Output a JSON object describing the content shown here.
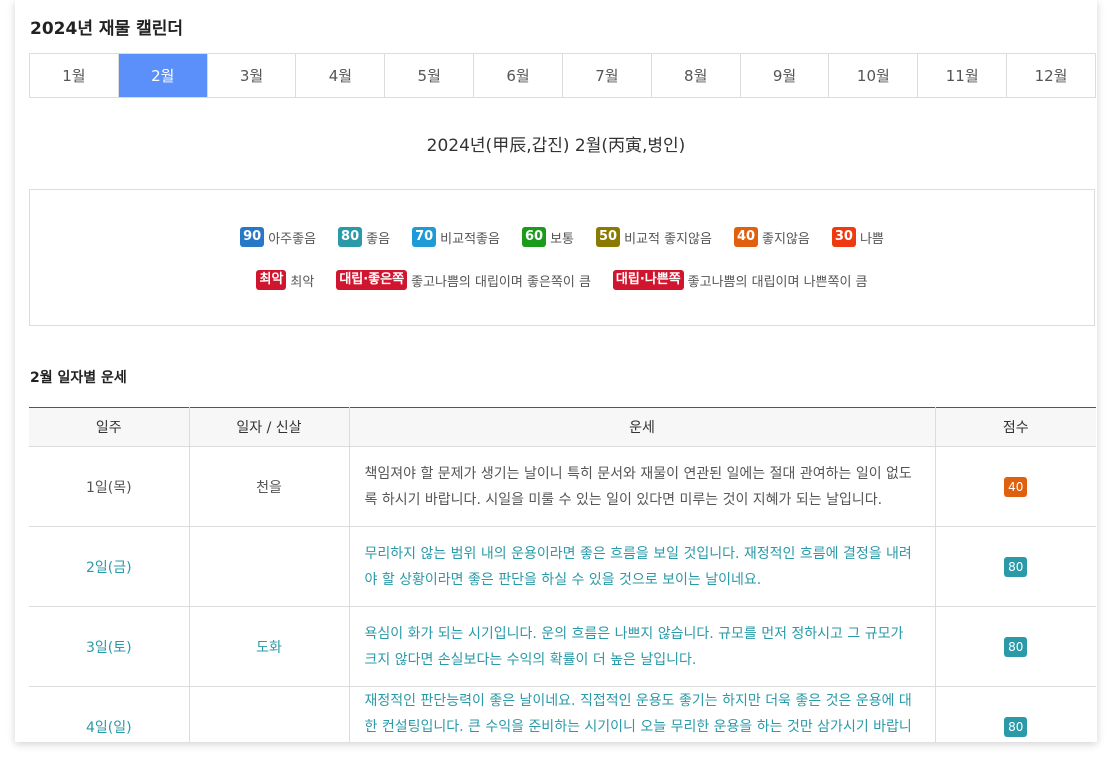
{
  "page_title": "2024년 재물 캘린더",
  "months": [
    "1월",
    "2월",
    "3월",
    "4월",
    "5월",
    "6월",
    "7월",
    "8월",
    "9월",
    "10월",
    "11월",
    "12월"
  ],
  "active_month_index": 1,
  "year_heading": "2024년(甲辰,갑진) 2월(丙寅,병인)",
  "legend": {
    "row1": [
      {
        "badge": "90",
        "label": "아주좋음",
        "color": "#2878c8"
      },
      {
        "badge": "80",
        "label": "좋음",
        "color": "#2a9aa8"
      },
      {
        "badge": "70",
        "label": "비교적좋음",
        "color": "#1e9bd7"
      },
      {
        "badge": "60",
        "label": "보통",
        "color": "#1a9c1a"
      },
      {
        "badge": "50",
        "label": "비교적 좋지않음",
        "color": "#8a7a00"
      },
      {
        "badge": "40",
        "label": "좋지않음",
        "color": "#e0600f"
      },
      {
        "badge": "30",
        "label": "나쁨",
        "color": "#ee3a10"
      }
    ],
    "row2": [
      {
        "badge": "최악",
        "label": "최악",
        "color": "#d0162e"
      },
      {
        "badge": "대립·좋은쪽",
        "label": "좋고나쁨의 대립이며 좋은쪽이 큼",
        "color": "#d0162e"
      },
      {
        "badge": "대립·나쁜쪽",
        "label": "좋고나쁨의 대립이며 나쁜쪽이 큼",
        "color": "#d0162e"
      }
    ]
  },
  "section_title": "2월 일자별 운세",
  "table": {
    "headers": [
      "일주",
      "일자 / 신살",
      "운세",
      "점수"
    ],
    "rows": [
      {
        "day": "1일(목)",
        "sinsal": "천을",
        "text": "책임져야 할 문제가 생기는 날이니 특히 문서와 재물이 연관된 일에는 절대 관여하는 일이 없도록 하시기 바랍니다. 시일을 미룰 수 있는 일이 있다면 미루는 것이 지혜가 되는 날입니다.",
        "score": "40",
        "score_color": "#e0600f",
        "tone": "bad"
      },
      {
        "day": "2일(금)",
        "sinsal": "",
        "text": "무리하지 않는 범위 내의 운용이라면 좋은 흐름을 보일 것입니다. 재정적인 흐름에 결정을 내려야 할 상황이라면 좋은 판단을 하실 수 있을 것으로 보이는 날이네요.",
        "score": "80",
        "score_color": "#2a9aa8",
        "tone": "good"
      },
      {
        "day": "3일(토)",
        "sinsal": "도화",
        "text": "욕심이 화가 되는 시기입니다. 운의 흐름은 나쁘지 않습니다. 규모를 먼저 정하시고 그 규모가 크지 않다면 손실보다는 수익의 확률이 더 높은 날입니다.",
        "score": "80",
        "score_color": "#2a9aa8",
        "tone": "good"
      },
      {
        "day": "4일(일)",
        "sinsal": "",
        "text": "재정적인 판단능력이 좋은 날이네요. 직접적인 운용도 좋기는 하지만 더욱 좋은 것은 운용에 대한 컨설팅입니다. 큰 수익을 준비하는 시기이니 오늘 무리한 운용을 하는 것만 삼가시기 바랍니다.",
        "score": "80",
        "score_color": "#2a9aa8",
        "tone": "good"
      }
    ]
  }
}
